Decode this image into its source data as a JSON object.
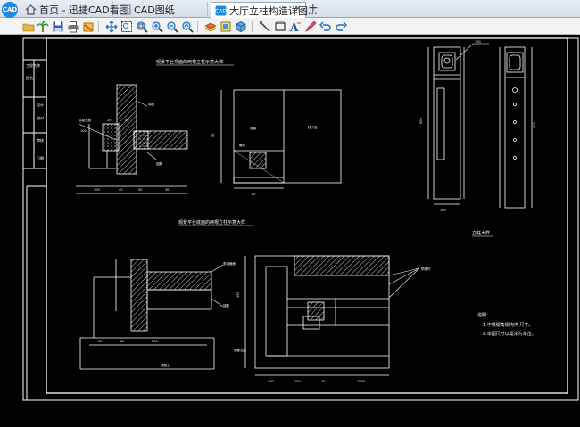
{
  "tabs": [
    {
      "label": "首页 - 迅捷CAD看图",
      "icon": "home-icon"
    },
    {
      "label": "CAD图纸",
      "icon": "grid-icon"
    },
    {
      "label": "大厅立柱构造详图...",
      "icon": "cad-file-icon"
    }
  ],
  "app_logo": "CAD",
  "new_tab": "+",
  "toolbar": {
    "icons": [
      "open-folder-icon",
      "palm-tree-icon",
      "save-icon",
      "print-icon",
      "clip-icon",
      "pan-icon",
      "zoom-window-icon",
      "zoom-extents-icon",
      "zoom-in-icon",
      "zoom-out-icon",
      "zoom-previous-icon",
      "layer-icon",
      "block-icon",
      "cube-icon",
      "line-icon",
      "rect-icon",
      "text-icon",
      "pen-icon",
      "undo-icon",
      "redo-icon"
    ]
  },
  "drawing": {
    "title_top_left": "观景平台顶面的两根立柱示意大样",
    "title_bottom_left": "观景平台底面的两根立柱示意大样",
    "title_right": "立柱大样",
    "notes_title": "说明：",
    "notes": [
      "1.不锈钢角钢构件 尺寸。",
      "2.本图尺寸以毫米为单位。"
    ],
    "dim_texts": [
      "100",
      "300",
      "40",
      "50",
      "30",
      "20",
      "40",
      "50",
      "80",
      "150",
      "200",
      "100",
      "50",
      "60",
      "600",
      "850",
      "1000",
      "150",
      "100",
      "400",
      "70",
      "30"
    ],
    "labels": [
      "混凝土面",
      "钢板",
      "钢筋",
      "角钢",
      "柱子面",
      "螺栓",
      "角钢截面",
      "锚筋",
      "混凝土",
      "钢管支座",
      "预埋件"
    ]
  }
}
